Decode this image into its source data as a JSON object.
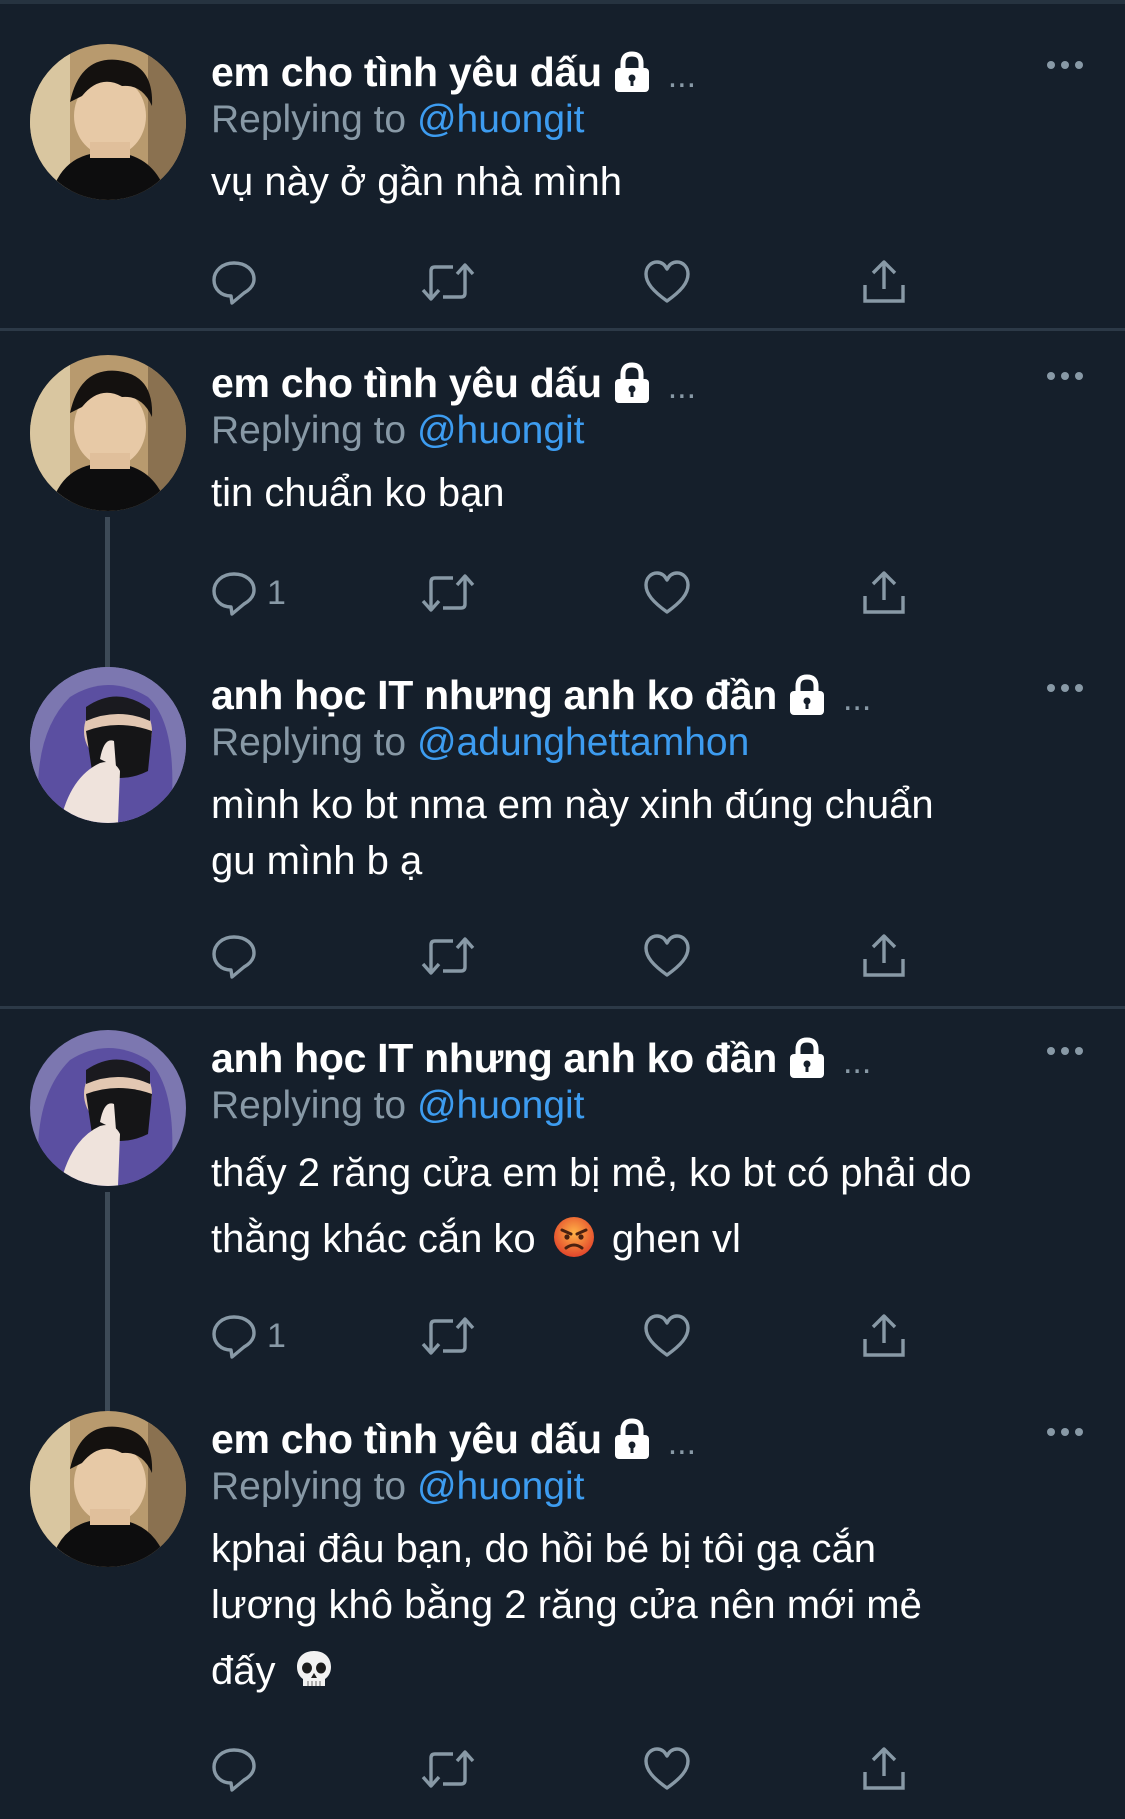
{
  "tweets": [
    {
      "name": "em cho tình yêu dấu",
      "handle": "...",
      "reply_prefix": "Replying to",
      "mention": "@huongit",
      "lines": [
        "vụ này ở gần nhà mình"
      ],
      "reply_count": "",
      "avatar": "boy-avatar"
    },
    {
      "name": "em cho tình yêu dấu",
      "handle": "...",
      "reply_prefix": "Replying to",
      "mention": "@huongit",
      "lines": [
        "tin chuẩn ko bạn"
      ],
      "reply_count": "1",
      "avatar": "boy-avatar"
    },
    {
      "name": "anh học IT nhưng anh ko đần",
      "handle": "...",
      "reply_prefix": "Replying to",
      "mention": "@adunghettamhon",
      "lines": [
        "mình ko bt nma em này xinh đúng chuẩn",
        "gu mình b ạ"
      ],
      "reply_count": "",
      "avatar": "masked-avatar"
    },
    {
      "name": "anh học IT nhưng anh ko đần",
      "handle": "...",
      "reply_prefix": "Replying to",
      "mention": "@huongit",
      "lines": [
        "thấy 2 răng cửa em bị mẻ, ko bt có phải do",
        "thằng khác cắn ko",
        "ghen vl"
      ],
      "reply_count": "1",
      "avatar": "masked-avatar"
    },
    {
      "name": "em cho tình yêu dấu",
      "handle": "...",
      "reply_prefix": "Replying to",
      "mention": "@huongit",
      "lines": [
        "kphai đâu bạn, do hồi bé bị tôi gạ cắn",
        "lương khô bằng 2 răng cửa nên mới mẻ",
        "đấy"
      ],
      "reply_count": "",
      "avatar": "boy-avatar"
    }
  ],
  "icons": {
    "lock": "lock-icon",
    "more": "more-options-icon",
    "reply": "reply-icon",
    "retweet": "retweet-icon",
    "like": "heart-icon",
    "share": "share-icon",
    "angry_emoji": "angry-face-emoji",
    "skull_emoji": "skull-emoji"
  },
  "colors": {
    "background": "#151f2b",
    "mention": "#3d9cf0",
    "muted": "#8899a6",
    "text": "#ffffff"
  }
}
